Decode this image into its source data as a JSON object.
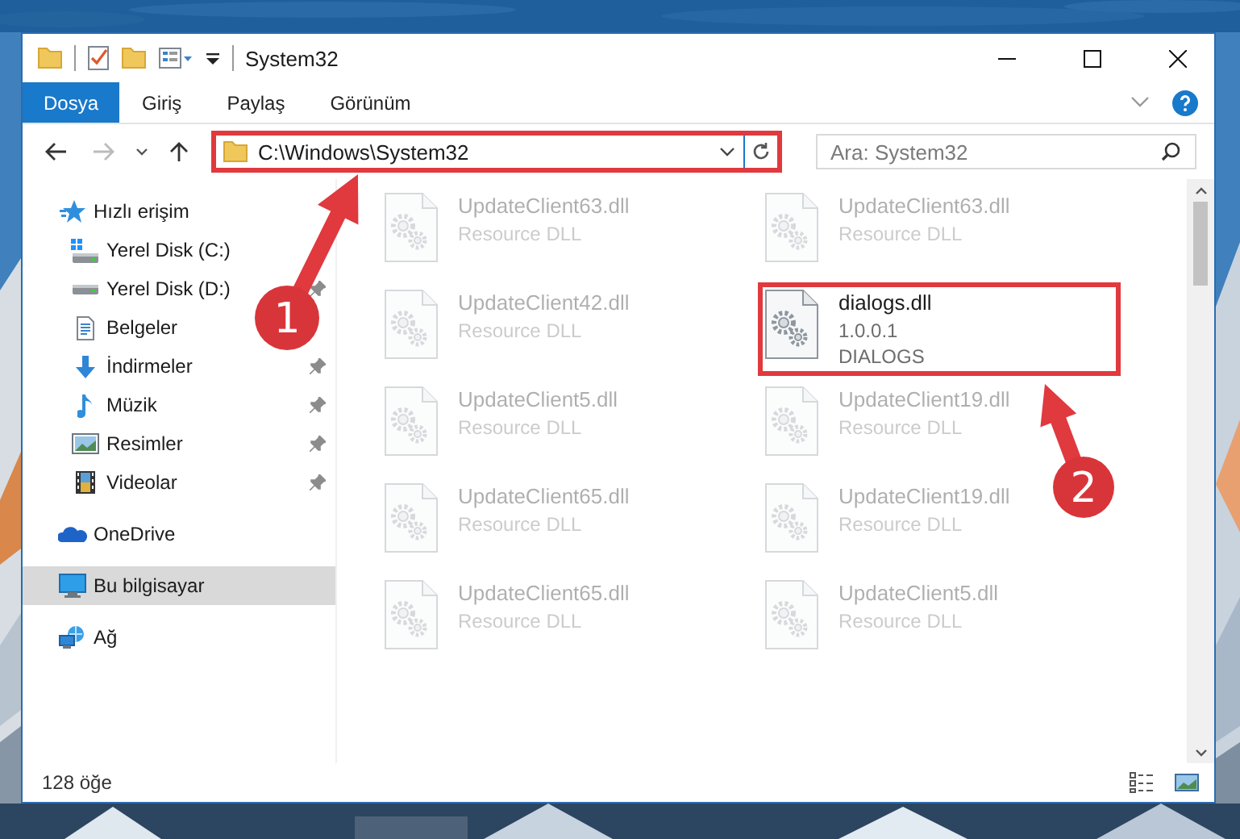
{
  "window": {
    "title": "System32"
  },
  "ribbon": {
    "tabs": [
      {
        "label": "Dosya",
        "kind": "file",
        "selected": false
      },
      {
        "label": "Giriş",
        "kind": "tab",
        "selected": false
      },
      {
        "label": "Paylaş",
        "kind": "tab",
        "selected": false
      },
      {
        "label": "Görünüm",
        "kind": "tab",
        "selected": false
      }
    ]
  },
  "address": {
    "path": "C:\\Windows\\System32",
    "highlighted": true
  },
  "search": {
    "placeholder": "Ara: System32"
  },
  "sidebar": {
    "items": [
      {
        "label": "Hızlı erişim",
        "kind": "star",
        "selected": false,
        "children": [
          {
            "label": "Yerel Disk (C:)",
            "kind": "drive-win",
            "selected": false,
            "pinned": false
          },
          {
            "label": "Yerel Disk (D:)",
            "kind": "drive",
            "selected": false,
            "pinned": true
          },
          {
            "label": "Belgeler",
            "kind": "documents",
            "selected": false,
            "pinned": false
          },
          {
            "label": "İndirmeler",
            "kind": "download",
            "selected": false,
            "pinned": true
          },
          {
            "label": "Müzik",
            "kind": "music",
            "selected": false,
            "pinned": true
          },
          {
            "label": "Resimler",
            "kind": "pictures",
            "selected": false,
            "pinned": true
          },
          {
            "label": "Videolar",
            "kind": "videos",
            "selected": false,
            "pinned": true
          }
        ]
      },
      {
        "label": "OneDrive",
        "kind": "cloud",
        "selected": false
      },
      {
        "label": "Bu bilgisayar",
        "kind": "computer",
        "selected": true
      },
      {
        "label": "Ağ",
        "kind": "network",
        "selected": false
      }
    ]
  },
  "files": [
    {
      "name": "UpdateClient63.dll",
      "lines": [
        "Resource DLL"
      ],
      "faded": true,
      "highlighted": false
    },
    {
      "name": "UpdateClient63.dll",
      "lines": [
        "Resource DLL"
      ],
      "faded": true,
      "highlighted": false
    },
    {
      "name": "UpdateClient42.dll",
      "lines": [
        "Resource DLL"
      ],
      "faded": true,
      "highlighted": false
    },
    {
      "name": "dialogs.dll",
      "lines": [
        "1.0.0.1",
        "DIALOGS"
      ],
      "faded": false,
      "highlighted": true
    },
    {
      "name": "UpdateClient5.dll",
      "lines": [
        "Resource DLL"
      ],
      "faded": true,
      "highlighted": false
    },
    {
      "name": "UpdateClient19.dll",
      "lines": [
        "Resource DLL"
      ],
      "faded": true,
      "highlighted": false
    },
    {
      "name": "UpdateClient65.dll",
      "lines": [
        "Resource DLL"
      ],
      "faded": true,
      "highlighted": false
    },
    {
      "name": "UpdateClient19.dll",
      "lines": [
        "Resource DLL"
      ],
      "faded": true,
      "highlighted": false
    },
    {
      "name": "UpdateClient65.dll",
      "lines": [
        "Resource DLL"
      ],
      "faded": true,
      "highlighted": false
    },
    {
      "name": "UpdateClient5.dll",
      "lines": [
        "Resource DLL"
      ],
      "faded": true,
      "highlighted": false
    }
  ],
  "status_bar": {
    "count": "128 öğe"
  },
  "annotations": [
    {
      "label": "1"
    },
    {
      "label": "2"
    }
  ]
}
